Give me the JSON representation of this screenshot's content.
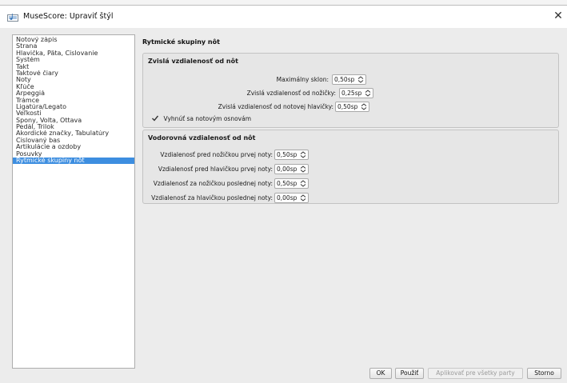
{
  "window": {
    "title": "MuseScore: Upraviť štýl",
    "app_icon": "musescore-icon",
    "close_glyph": "✕"
  },
  "sidebar": {
    "items": [
      {
        "label": "Notový zápis"
      },
      {
        "label": "Strana"
      },
      {
        "label": "Hlavička, Päta, Číslovanie"
      },
      {
        "label": "Systém"
      },
      {
        "label": "Takt"
      },
      {
        "label": "Taktové čiary"
      },
      {
        "label": "Noty"
      },
      {
        "label": "Kľúče"
      },
      {
        "label": "Arpeggiá"
      },
      {
        "label": "Trámce"
      },
      {
        "label": "Ligatúra/Legato"
      },
      {
        "label": "Veľkosti"
      },
      {
        "label": "Spony, Volta, Ottava"
      },
      {
        "label": "Pedál, Trilok"
      },
      {
        "label": "Akordické značky, Tabulatúry"
      },
      {
        "label": "Číslovaný bas"
      },
      {
        "label": "Artikulácie a ozdoby"
      },
      {
        "label": "Posuvky"
      },
      {
        "label": "Rytmické skupiny nôt"
      }
    ],
    "selected": "Rytmické skupiny nôt"
  },
  "main": {
    "title": "Rytmické skupiny nôt",
    "vertical": {
      "title": "Zvislá vzdialenosť od nôt",
      "fields": [
        {
          "label": "Maximálny sklon:",
          "value": "0,50sp"
        },
        {
          "label": "Zvislá vzdialenosť od nožičky:",
          "value": "0,25sp"
        },
        {
          "label": "Zvislá vzdialenosť od notovej hlavičky:",
          "value": "0,50sp"
        }
      ],
      "checkbox": {
        "label": "Vyhnúť sa notovým osnovám",
        "checked": true
      }
    },
    "horizontal": {
      "title": "Vodorovná vzdialenosť od nôt",
      "fields": [
        {
          "label": "Vzdialenosť pred nožičkou prvej noty:",
          "value": "0,50sp"
        },
        {
          "label": "Vzdialenosť pred hlavičkou prvej noty:",
          "value": "0,00sp"
        },
        {
          "label": "Vzdialenosť za nožičkou poslednej noty:",
          "value": "0,50sp"
        },
        {
          "label": "Vzdialenosť za hlavičkou poslednej noty:",
          "value": "0,00sp"
        }
      ]
    }
  },
  "footer": {
    "ok": "OK",
    "apply": "Použiť",
    "apply_all": "Aplikovať pre všetky party",
    "cancel": "Storno",
    "apply_all_enabled": false
  },
  "colors": {
    "selection": "#3d8ee0",
    "window_bg": "#ececec",
    "group_bg": "#e6e6e6"
  }
}
